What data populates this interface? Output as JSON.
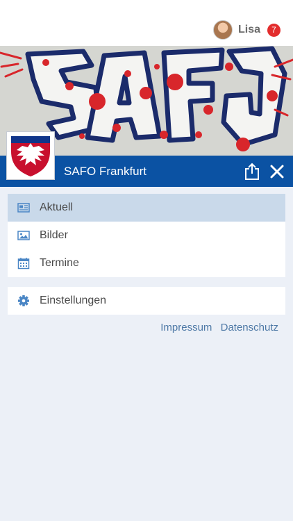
{
  "user": {
    "name": "Lisa",
    "notification_count": "7"
  },
  "group": {
    "name": "SAFO Frankfurt"
  },
  "menu_main": [
    {
      "label": "Aktuell",
      "icon": "newspaper-icon",
      "active": true
    },
    {
      "label": "Bilder",
      "icon": "image-icon",
      "active": false
    },
    {
      "label": "Termine",
      "icon": "calendar-icon",
      "active": false
    }
  ],
  "menu_settings": {
    "label": "Einstellungen",
    "icon": "gear-icon"
  },
  "footer": {
    "impressum": "Impressum",
    "datenschutz": "Datenschutz"
  },
  "colors": {
    "brand_blue": "#0b52a3",
    "active_row": "#c9d9ea",
    "icon_blue": "#4a86c5",
    "badge_red": "#e32d2d",
    "page_bg": "#ecf0f7"
  }
}
